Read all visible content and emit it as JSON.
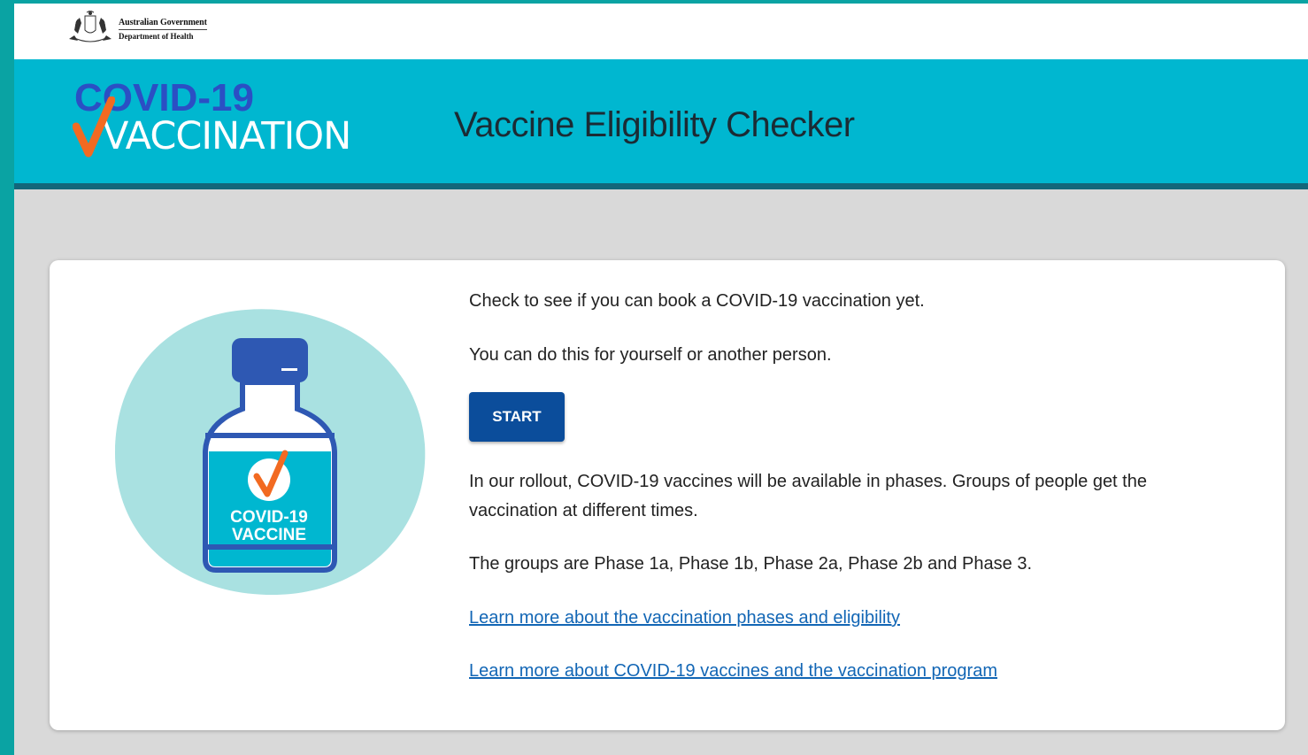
{
  "header": {
    "gov_line1": "Australian Government",
    "gov_line2": "Department of Health"
  },
  "banner": {
    "logo_line1": "COVID-19",
    "logo_line2": "VACCINATION",
    "title": "Vaccine Eligibility Checker"
  },
  "card": {
    "illustration_label_line1": "COVID-19",
    "illustration_label_line2": "VACCINE",
    "intro": "Check to see if you can book a COVID-19 vaccination yet.",
    "intro2": "You can do this for yourself or another person.",
    "start_label": "START",
    "rollout": "In our rollout, COVID-19 vaccines will be available in phases. Groups of people get the vaccination at different times.",
    "groups": "The groups are Phase 1a, Phase 1b, Phase 2a, Phase 2b and Phase 3.",
    "link_phases": "Learn more about the vaccination phases and eligibility",
    "link_program": "Learn more about COVID-19 vaccines and the vaccination program"
  },
  "colors": {
    "outer_border": "#0aa3a3",
    "banner": "#00b7d0",
    "banner_border": "#13667a",
    "button": "#0b4d9b",
    "link": "#1266b5",
    "logo_blue": "#2b4fc4",
    "tick_orange": "#f26a21"
  },
  "icons": [
    "coat-of-arms-icon",
    "checkmark-icon",
    "vaccine-bottle-icon"
  ]
}
